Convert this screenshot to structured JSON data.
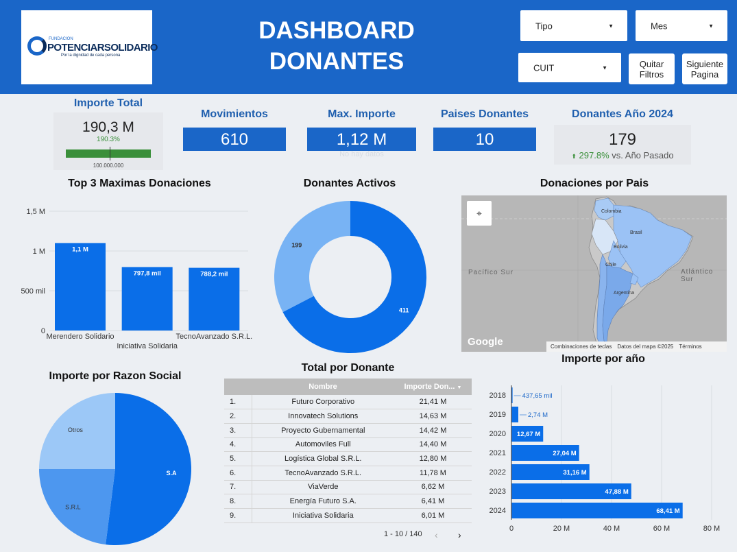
{
  "header": {
    "title": "DASHBOARD DONANTES",
    "logo": {
      "small": "FUNDACION",
      "name": "POTENCIARSOLIDARIO",
      "tagline": "Por la dignidad de cada persona"
    },
    "filters": {
      "tipo": "Tipo",
      "mes": "Mes",
      "cuit": "CUIT"
    },
    "buttons": {
      "quitar": "Quitar Filtros",
      "siguiente": "Siguiente Pagina"
    }
  },
  "kpis": {
    "importe_total": {
      "title": "Importe Total",
      "value": "190,3 M",
      "delta": "190.3%",
      "target": "100.000.000",
      "progress": 1.0
    },
    "movimientos": {
      "title": "Movimientos",
      "value": "610"
    },
    "max_importe": {
      "title": "Max. Importe",
      "value": "1,12 M",
      "note": "No hay datos"
    },
    "paises": {
      "title": "Paises Donantes",
      "value": "10"
    },
    "donantes_2024": {
      "title": "Donantes Año 2024",
      "value": "179",
      "delta": "297.8%",
      "delta_label": "vs. Año Pasado"
    }
  },
  "colors": {
    "primary": "#1a66c8",
    "bar": "#0a6ee8",
    "light": "#78b3f4",
    "lighter": "#9cc8f7",
    "green": "#3a8f3a"
  },
  "chart_data": [
    {
      "type": "bar",
      "title": "Top 3 Maximas Donaciones",
      "categories": [
        "Merendero Solidario",
        "Iniciativa Solidaria",
        "TecnoAvanzado S.R.L."
      ],
      "values": [
        1100000,
        797800,
        788200
      ],
      "labels": [
        "1,1 M",
        "797,8 mil",
        "788,2 mil"
      ],
      "yticks": [
        "0",
        "500 mil",
        "1 M",
        "1,5 M"
      ],
      "ylim": [
        0,
        1500000
      ]
    },
    {
      "type": "pie",
      "title": "Donantes Activos",
      "donut": true,
      "values": [
        411,
        199
      ],
      "labels": [
        "411",
        "199"
      ]
    },
    {
      "type": "pie",
      "title": "Importe por Razon Social",
      "categories": [
        "S.A",
        "S.R.L",
        "Otros"
      ],
      "values": [
        52,
        23,
        25
      ]
    },
    {
      "type": "bar",
      "orientation": "horizontal",
      "title": "Importe por año",
      "categories": [
        "2018",
        "2019",
        "2020",
        "2021",
        "2022",
        "2023",
        "2024"
      ],
      "values": [
        0.43765,
        2.74,
        12.67,
        27.04,
        31.16,
        47.88,
        68.41
      ],
      "labels": [
        "437,65 mil",
        "2,74 M",
        "12,67 M",
        "27,04 M",
        "31,16 M",
        "47,88 M",
        "68,41 M"
      ],
      "xticks": [
        "0",
        "20 M",
        "40 M",
        "60 M",
        "80 M"
      ],
      "xlim": [
        0,
        80
      ]
    }
  ],
  "map": {
    "title": "Donaciones por Pais",
    "labels": {
      "colombia": "Colombia",
      "brasil": "Brasil",
      "bolivia": "Bolivia",
      "chile": "Chile",
      "argentina": "Argentina",
      "pacifico": "Pacífico Sur",
      "atlantico": "Atlántico Sur"
    },
    "google": "Google",
    "footer": [
      "Combinaciones de teclas",
      "Datos del mapa ©2025",
      "Términos"
    ]
  },
  "table": {
    "title": "Total por Donante",
    "columns": [
      "Nombre",
      "Importe Don..."
    ],
    "rows": [
      [
        "1.",
        "Futuro Corporativo",
        "21,41 M"
      ],
      [
        "2.",
        "Innovatech Solutions",
        "14,63 M"
      ],
      [
        "3.",
        "Proyecto Gubernamental",
        "14,42 M"
      ],
      [
        "4.",
        "Automoviles Full",
        "14,40 M"
      ],
      [
        "5.",
        "Logística Global S.R.L.",
        "12,80 M"
      ],
      [
        "6.",
        "TecnoAvanzado S.R.L.",
        "11,78 M"
      ],
      [
        "7.",
        "ViaVerde",
        "6,62 M"
      ],
      [
        "8.",
        "Energía Futuro S.A.",
        "6,41 M"
      ],
      [
        "9.",
        "Iniciativa Solidaria",
        "6,01 M"
      ]
    ],
    "pagination": "1 - 10 / 140"
  }
}
